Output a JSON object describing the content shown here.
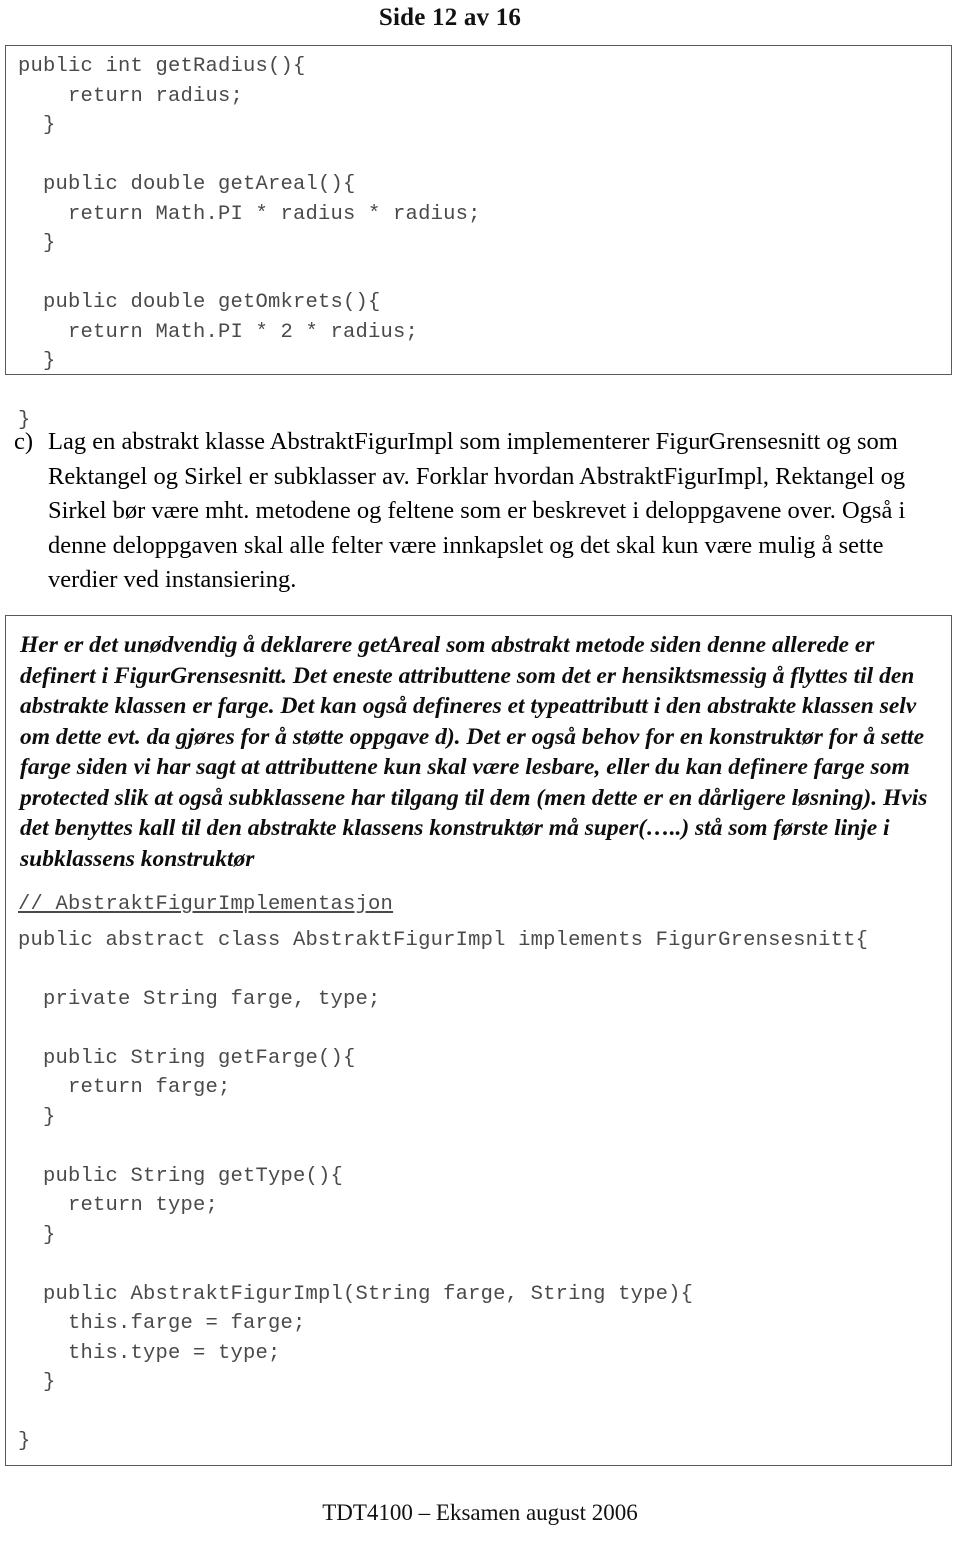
{
  "header": {
    "page_label": "Side 12 av 16"
  },
  "code_top": "public int getRadius(){\n    return radius;\n  }\n\n  public double getAreal(){\n    return Math.PI * radius * radius;\n  }\n\n  public double getOmkrets(){\n    return Math.PI * 2 * radius;\n  }\n\n}",
  "task": {
    "marker": "c)",
    "text": "Lag en abstrakt klasse AbstraktFigurImpl som implementerer FigurGrensesnitt og som Rektangel og Sirkel er subklasser av. Forklar hvordan AbstraktFigurImpl, Rektangel og Sirkel  bør være mht. metodene og feltene som er beskrevet i deloppgavene over. Også i denne deloppgaven skal alle felter være innkapslet og det skal kun være mulig å sette verdier ved instansiering."
  },
  "note": {
    "paragraph": "Her er det unødvendig å deklarere getAreal som abstrakt metode siden denne allerede er definert i FigurGrensesnitt. Det eneste attributtene som det er hensiktsmessig å flyttes til den abstrakte klassen er farge. Det kan også defineres et typeattributt i den abstrakte klassen selv om dette evt. da gjøres for å støtte oppgave d). Det er også behov for en konstruktør for å sette farge siden vi har sagt at attributtene kun skal være lesbare, eller du kan definere farge som protected slik at også subklassene har tilgang til dem (men dette er en dårligere løsning). Hvis det benyttes kall til den abstrakte klassens konstruktør må super(…..) stå som første linje i subklassens konstruktør"
  },
  "code_comment": "// AbstraktFigurImplementasjon",
  "code_bottom": "public abstract class AbstraktFigurImpl implements FigurGrensesnitt{\n\n  private String farge, type;\n\n  public String getFarge(){\n    return farge;\n  }\n\n  public String getType(){\n    return type;\n  }\n\n  public AbstraktFigurImpl(String farge, String type){\n    this.farge = farge;\n    this.type = type;\n  }\n\n}",
  "footer": {
    "text": "TDT4100 – Eksamen august 2006"
  },
  "colors": {
    "code_text": "#4a4a4a",
    "body_text": "#000000",
    "box_border": "#5a5a5a",
    "background": "#ffffff"
  }
}
